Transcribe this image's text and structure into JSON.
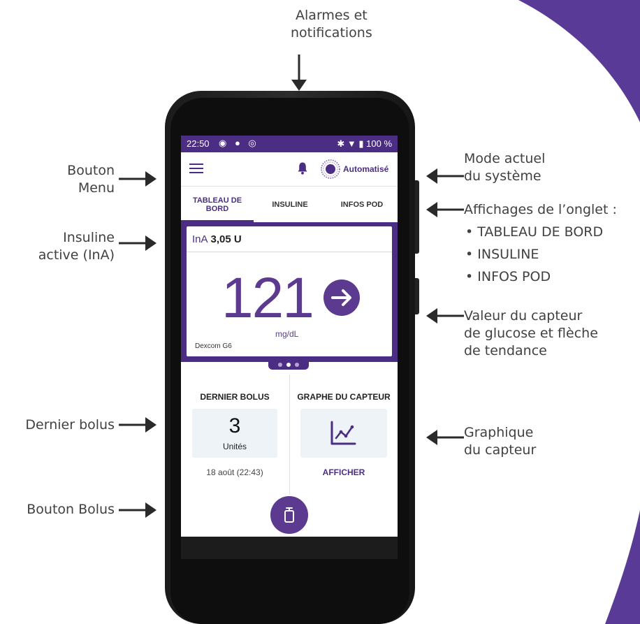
{
  "annotations": {
    "alarms_line1": "Alarmes et",
    "alarms_line2": "notifications",
    "menu_line1": "Bouton",
    "menu_line2": "Menu",
    "iob_line1": "Insuline",
    "iob_line2": "active (InA)",
    "last_bolus": "Dernier bolus",
    "bolus_button": "Bouton Bolus",
    "mode_line1": "Mode actuel",
    "mode_line2": "du système",
    "tabs_title": "Affichages de l’onglet :",
    "tabs_item1": "• TABLEAU DE BORD",
    "tabs_item2": "• INSULINE",
    "tabs_item3": "• INFOS POD",
    "sensor_line1": "Valeur du capteur",
    "sensor_line2": "de glucose et flèche",
    "sensor_line3": "de tendance",
    "graph_line1": "Graphique",
    "graph_line2": "du capteur"
  },
  "statusbar": {
    "time": "22:50",
    "left_icons": "◉ ● ◎",
    "right": "✱ ▼ ▮ 100 %"
  },
  "appbar": {
    "menu_icon": "hamburger-icon",
    "bell_icon": "bell-icon",
    "mode_label": "Automatisé"
  },
  "tabs": [
    {
      "label_line1": "TABLEAU DE",
      "label_line2": "BORD",
      "active": true
    },
    {
      "label": "INSULINE",
      "active": false
    },
    {
      "label": "INFOS POD",
      "active": false
    }
  ],
  "cgm": {
    "iob_label": "InA",
    "iob_value": "3,05 U",
    "glucose_value": "121",
    "unit": "mg/dL",
    "sensor_name": "Dexcom G6",
    "trend": "steady",
    "page_indicator": {
      "count": 3,
      "active": 1
    }
  },
  "last_bolus": {
    "title": "DERNIER BOLUS",
    "value": "3",
    "unit": "Unités",
    "date": "18 août (22:43)"
  },
  "sensor_graph": {
    "title": "GRAPHE DU CAPTEUR",
    "button": "AFFICHER"
  },
  "colors": {
    "brand_purple": "#4b2e83",
    "glucose_purple": "#5b3a8f",
    "card_bg": "#eef3f8"
  }
}
